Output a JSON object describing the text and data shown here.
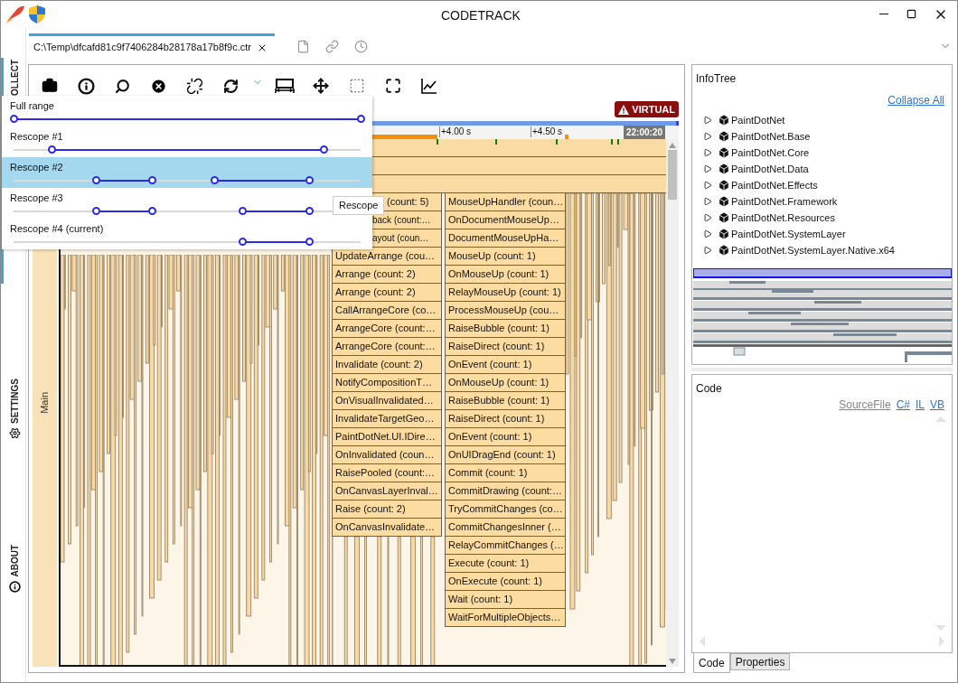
{
  "window": {
    "title": "CODETRACK"
  },
  "sidebar": {
    "items": [
      {
        "label": "OLLECT",
        "kind": "collect",
        "selected": true
      },
      {
        "label": "SETTINGS",
        "kind": "settings",
        "selected": false
      },
      {
        "label": "ABOUT",
        "kind": "about",
        "selected": false
      }
    ]
  },
  "document_tab": {
    "label": "C:\\Temp\\dfcafd81c9f7406284b28178a17b8f9c.ctr",
    "selected": true
  },
  "badge": "VIRTUAL",
  "timeline": {
    "ticks": [
      "+4.00 s",
      "+4.50 s"
    ],
    "time": "22:00:20"
  },
  "thread_label": "Main",
  "flame": {
    "column_a": [
      {
        "label": "(count: 5)",
        "kind": "under_tooltip"
      },
      {
        "label": "back (count:…",
        "kind": "under_menu"
      },
      {
        "label": "ayout (coun…",
        "kind": "under_menu"
      },
      {
        "label": "UpdateArrange (cou…",
        "kind": "full"
      },
      {
        "label": "Arrange (count: 2)",
        "kind": "full"
      },
      {
        "label": "Arrange (count: 2)",
        "kind": "full"
      },
      {
        "label": "CallArrangeCore (co…",
        "kind": "full"
      },
      {
        "label": "ArrangeCore (count:…",
        "kind": "full"
      },
      {
        "label": "ArrangeCore (count:…",
        "kind": "full"
      },
      {
        "label": "Invalidate (count: 2)",
        "kind": "full"
      },
      {
        "label": "NotifyCompositionT…",
        "kind": "full"
      },
      {
        "label": "OnVisualInvalidated…",
        "kind": "full"
      },
      {
        "label": "InvalidateTargetGeo…",
        "kind": "full"
      },
      {
        "label": "PaintDotNet.UI.IDire…",
        "kind": "full"
      },
      {
        "label": "OnInvalidated (coun…",
        "kind": "full"
      },
      {
        "label": "RaisePooled (count:…",
        "kind": "full"
      },
      {
        "label": "OnCanvasLayerInval…",
        "kind": "full"
      },
      {
        "label": "Raise (count: 2)",
        "kind": "full"
      },
      {
        "label": "OnCanvasInvalidate…",
        "kind": "full"
      }
    ],
    "column_b": [
      "MouseUpHandler (coun…",
      "OnDocumentMouseUp…",
      "DocumentMouseUpHa…",
      "MouseUp (count: 1)",
      "OnMouseUp (count: 1)",
      "RelayMouseUp (count: 1)",
      "ProcessMouseUp (cou…",
      "RaiseBubble (count: 1)",
      "RaiseDirect (count: 1)",
      "OnEvent (count: 1)",
      "OnMouseUp (count: 1)",
      "RaiseBubble (count: 1)",
      "RaiseDirect (count: 1)",
      "OnEvent (count: 1)",
      "OnUIDragEnd (count: 1)",
      "Commit (count: 1)",
      "CommitDrawing (count:…",
      "TryCommitChanges (co…",
      "CommitChangesInner (…",
      "RelayCommitChanges (…",
      "Execute (count: 1)",
      "OnExecute (count: 1)",
      "Wait (count: 1)",
      "WaitForMultipleObjects…"
    ]
  },
  "rescope_menu": {
    "items": [
      {
        "label": "Full range",
        "selected": false,
        "thumbs": [
          {
            "level": 0
          },
          {
            "level": 1
          }
        ]
      },
      {
        "label": "Rescope #1",
        "selected": false,
        "thumbs": [
          {
            "level": 0.109
          },
          {
            "level": 0.894
          }
        ]
      },
      {
        "label": "Rescope #2",
        "selected": true,
        "thumbs": [
          {
            "level": 0.236
          },
          {
            "level": 0.399
          },
          {
            "level": 0.578
          },
          {
            "level": 0.852
          }
        ]
      },
      {
        "label": "Rescope #3",
        "selected": false,
        "thumbs": [
          {
            "level": 0.236
          },
          {
            "level": 0.399
          },
          {
            "level": 0.658
          },
          {
            "level": 0.852
          }
        ]
      },
      {
        "label": "Rescope #4 (current)",
        "selected": false,
        "thumbs": [
          {
            "level": 0.658
          },
          {
            "level": 0.852
          }
        ]
      }
    ]
  },
  "tooltip": "Rescope",
  "info_tree": {
    "title": "InfoTree",
    "collapse_all": "Collapse All",
    "items": [
      {
        "label": "PaintDotNet",
        "expanded": false
      },
      {
        "label": "PaintDotNet.Base",
        "expanded": false
      },
      {
        "label": "PaintDotNet.Core",
        "expanded": false
      },
      {
        "label": "PaintDotNet.Data",
        "expanded": false
      },
      {
        "label": "PaintDotNet.Effects",
        "expanded": false
      },
      {
        "label": "PaintDotNet.Framework",
        "expanded": false
      },
      {
        "label": "PaintDotNet.Resources",
        "expanded": false
      },
      {
        "label": "PaintDotNet.SystemLayer",
        "expanded": false
      },
      {
        "label": "PaintDotNet.SystemLayer.Native.x64",
        "expanded": false
      }
    ]
  },
  "code_panel": {
    "title": "Code",
    "links": [
      {
        "label": "SourceFile",
        "disabled": true
      },
      {
        "label": "C#",
        "disabled": false
      },
      {
        "label": "IL",
        "disabled": false
      },
      {
        "label": "VB",
        "disabled": false
      }
    ]
  },
  "bottom_tabs": [
    {
      "label": "Code",
      "selected": true
    },
    {
      "label": "Properties",
      "selected": false
    }
  ]
}
